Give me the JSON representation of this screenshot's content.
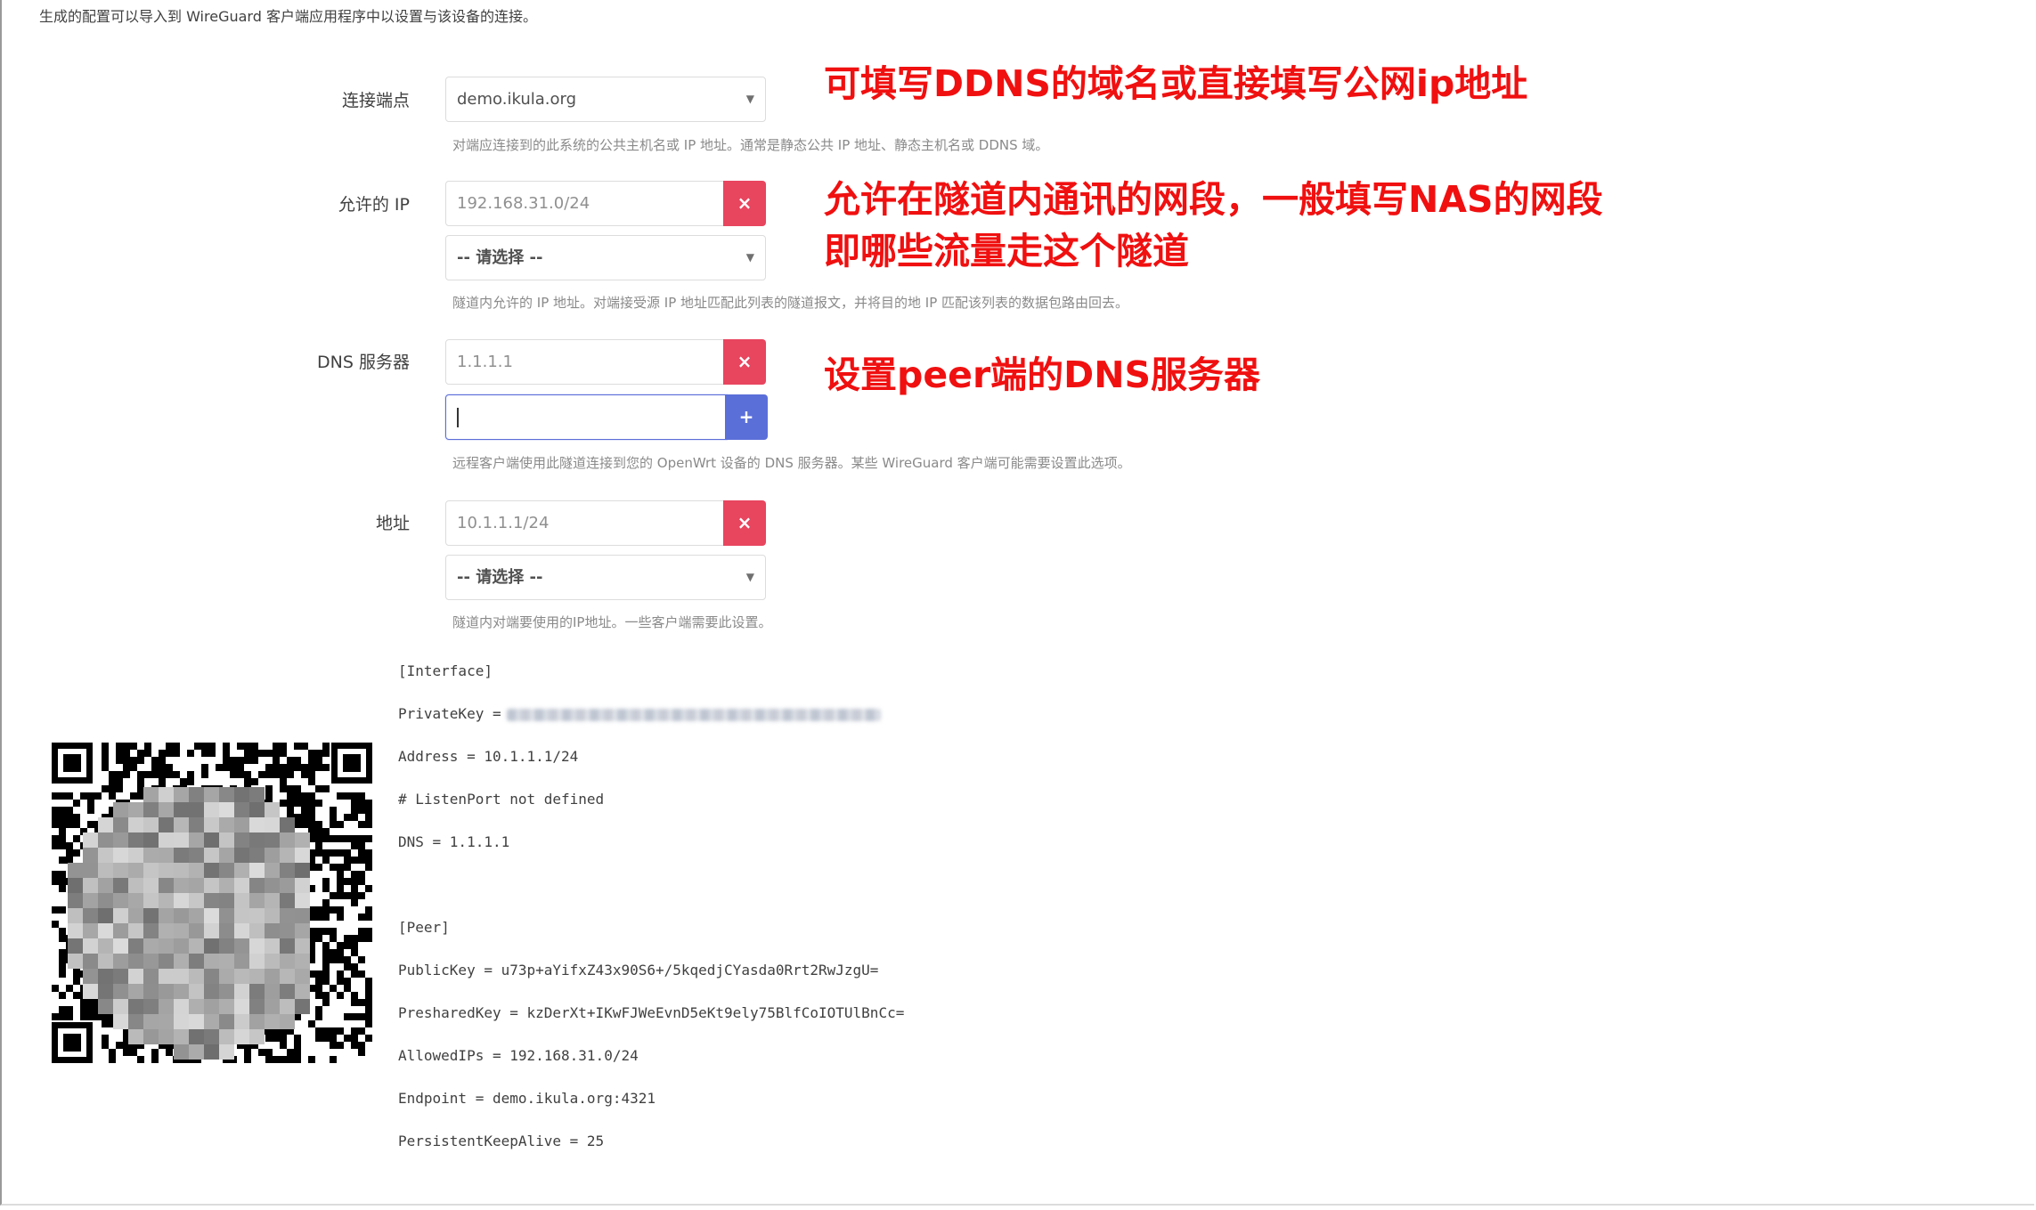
{
  "intro": "生成的配置可以导入到 WireGuard 客户端应用程序中以设置与该设备的连接。",
  "endpoint": {
    "label": "连接端点",
    "value": "demo.ikula.org",
    "help": "对端应连接到的此系统的公共主机名或 IP 地址。通常是静态公共 IP 地址、静态主机名或 DDNS 域。",
    "note": "可填写DDNS的域名或直接填写公网ip地址"
  },
  "allowed_ips": {
    "label": "允许的 IP",
    "value": "192.168.31.0/24",
    "select_placeholder": "-- 请选择 --",
    "help": "隧道内允许的 IP 地址。对端接受源 IP 地址匹配此列表的隧道报文，并将目的地 IP 匹配该列表的数据包路由回去。",
    "note_line1": "允许在隧道内通讯的网段，一般填写NAS的网段",
    "note_line2": "即哪些流量走这个隧道"
  },
  "dns": {
    "label": "DNS 服务器",
    "value": "1.1.1.1",
    "new_value": "",
    "help": "远程客户端使用此隧道连接到您的 OpenWrt 设备的 DNS 服务器。某些 WireGuard 客户端可能需要设置此选项。",
    "note": "设置peer端的DNS服务器"
  },
  "address": {
    "label": "地址",
    "value": "10.1.1.1/24",
    "select_placeholder": "-- 请选择 --",
    "help": "隧道内对端要使用的IP地址。一些客户端需要此设置。"
  },
  "buttons": {
    "remove": "×",
    "add": "+"
  },
  "icons": {
    "dropdown": "dropdown-arrow-icon",
    "qr": "qr-code"
  },
  "colors": {
    "remove": "#e8455f",
    "add": "#5b6fd9",
    "annotation": "#f01010"
  },
  "config": {
    "interface": "[Interface]",
    "private_key_label": "PrivateKey =",
    "address": "Address = 10.1.1.1/24",
    "listen_port": "# ListenPort not defined",
    "dns": "DNS = 1.1.1.1",
    "peer": "[Peer]",
    "public_key": "PublicKey = u73p+aYifxZ43x90S6+/5kqedjCYasda0Rrt2RwJzgU=",
    "preshared_key": "PresharedKey = kzDerXt+IKwFJWeEvnD5eKt9ely75BlfCoIOTUlBnCc=",
    "allowed_ips": "AllowedIPs = 192.168.31.0/24",
    "endpoint": "Endpoint = demo.ikula.org:4321",
    "keepalive": "PersistentKeepAlive = 25"
  }
}
